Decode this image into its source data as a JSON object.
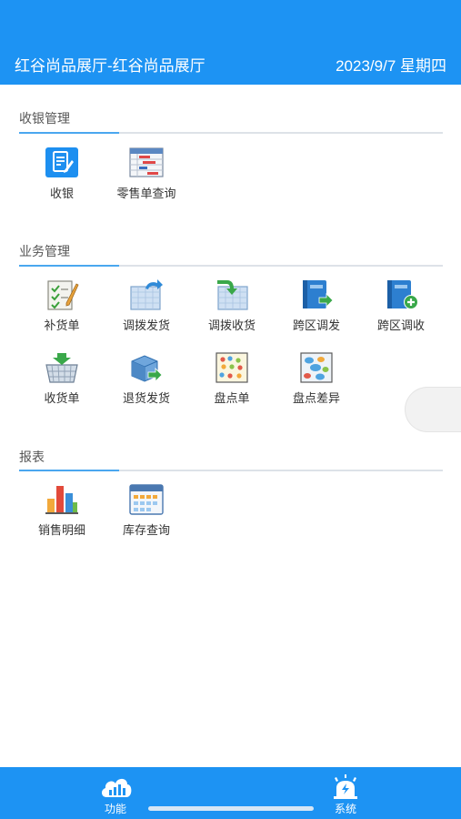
{
  "header": {
    "store": "红谷尚品展厅-红谷尚品展厅",
    "date": "2023/9/7 星期四"
  },
  "sections": [
    {
      "title": "收银管理",
      "items": [
        {
          "label": "收银",
          "icon": "cashier-icon"
        },
        {
          "label": "零售单查询",
          "icon": "retail-order-query-icon"
        }
      ]
    },
    {
      "title": "业务管理",
      "items": [
        {
          "label": "补货单",
          "icon": "replenish-order-icon"
        },
        {
          "label": "调拨发货",
          "icon": "transfer-ship-icon"
        },
        {
          "label": "调拨收货",
          "icon": "transfer-receive-icon"
        },
        {
          "label": "跨区调发",
          "icon": "cross-region-ship-icon"
        },
        {
          "label": "跨区调收",
          "icon": "cross-region-receive-icon"
        },
        {
          "label": "收货单",
          "icon": "receiving-basket-icon"
        },
        {
          "label": "退货发货",
          "icon": "return-ship-icon"
        },
        {
          "label": "盘点单",
          "icon": "stocktake-icon"
        },
        {
          "label": "盘点差异",
          "icon": "stocktake-diff-icon"
        }
      ]
    },
    {
      "title": "报表",
      "items": [
        {
          "label": "销售明细",
          "icon": "bar-chart-icon"
        },
        {
          "label": "库存查询",
          "icon": "calendar-grid-icon"
        }
      ]
    }
  ],
  "tabbar": {
    "function_label": "功能",
    "system_label": "系统"
  },
  "colors": {
    "primary": "#1d93f3",
    "section_accent": "#4aa7ef",
    "divider": "#dde2e8"
  }
}
